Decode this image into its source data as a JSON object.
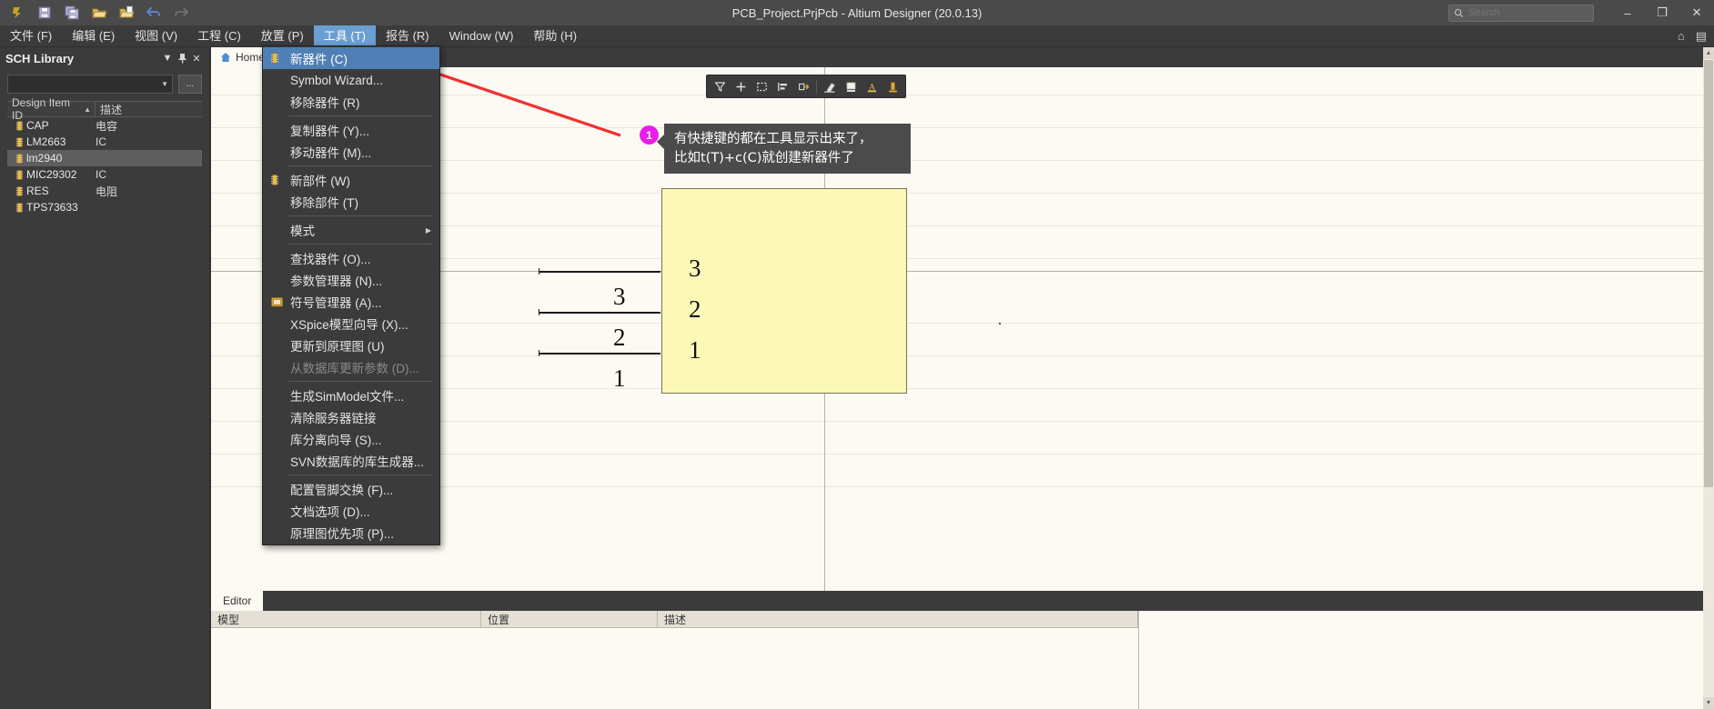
{
  "titlebar": {
    "title": "PCB_Project.PrjPcb - Altium Designer (20.0.13)",
    "quick_icons": [
      {
        "name": "altium-logo-icon",
        "glyph": "A"
      },
      {
        "name": "save-icon",
        "glyph": "save"
      },
      {
        "name": "save-all-icon",
        "glyph": "saveall"
      },
      {
        "name": "open-folder-icon",
        "glyph": "folder"
      },
      {
        "name": "open-project-icon",
        "glyph": "folder2"
      },
      {
        "name": "undo-icon",
        "glyph": "undo"
      },
      {
        "name": "redo-icon",
        "glyph": "redo"
      }
    ],
    "search_placeholder": "Search",
    "search_value": "",
    "minimize_label": "–",
    "maximize_label": "❐",
    "close_label": "✕"
  },
  "menubar": {
    "items": [
      {
        "label": "文件 (F)",
        "active": false
      },
      {
        "label": "编辑 (E)",
        "active": false
      },
      {
        "label": "视图 (V)",
        "active": false
      },
      {
        "label": "工程 (C)",
        "active": false
      },
      {
        "label": "放置 (P)",
        "active": false
      },
      {
        "label": "工具 (T)",
        "active": true
      },
      {
        "label": "报告 (R)",
        "active": false
      },
      {
        "label": "Window (W)",
        "active": false
      },
      {
        "label": "帮助 (H)",
        "active": false
      }
    ],
    "right_icons": [
      {
        "name": "home-icon",
        "glyph": "⌂"
      },
      {
        "name": "panels-icon",
        "glyph": "▤"
      }
    ]
  },
  "tools_menu": {
    "items": [
      {
        "label": "新器件 (C)",
        "icon": "component-icon",
        "highlighted": true,
        "disabled": false,
        "separator_after": false,
        "submenu": false
      },
      {
        "label": "Symbol Wizard...",
        "icon": "",
        "highlighted": false,
        "disabled": false,
        "separator_after": false,
        "submenu": false
      },
      {
        "label": "移除器件 (R)",
        "icon": "",
        "highlighted": false,
        "disabled": false,
        "separator_after": true,
        "submenu": false
      },
      {
        "label": "复制器件 (Y)...",
        "icon": "",
        "highlighted": false,
        "disabled": false,
        "separator_after": false,
        "submenu": false
      },
      {
        "label": "移动器件 (M)...",
        "icon": "",
        "highlighted": false,
        "disabled": false,
        "separator_after": true,
        "submenu": false
      },
      {
        "label": "新部件 (W)",
        "icon": "component-icon",
        "highlighted": false,
        "disabled": false,
        "separator_after": false,
        "submenu": false
      },
      {
        "label": "移除部件 (T)",
        "icon": "",
        "highlighted": false,
        "disabled": false,
        "separator_after": true,
        "submenu": false
      },
      {
        "label": "模式",
        "icon": "",
        "highlighted": false,
        "disabled": false,
        "separator_after": true,
        "submenu": true
      },
      {
        "label": "查找器件 (O)...",
        "icon": "",
        "highlighted": false,
        "disabled": false,
        "separator_after": false,
        "submenu": false
      },
      {
        "label": "参数管理器 (N)...",
        "icon": "",
        "highlighted": false,
        "disabled": false,
        "separator_after": false,
        "submenu": false
      },
      {
        "label": "符号管理器 (A)...",
        "icon": "symbol-manager-icon",
        "highlighted": false,
        "disabled": false,
        "separator_after": false,
        "submenu": false
      },
      {
        "label": "XSpice模型向导 (X)...",
        "icon": "",
        "highlighted": false,
        "disabled": false,
        "separator_after": false,
        "submenu": false
      },
      {
        "label": "更新到原理图 (U)",
        "icon": "",
        "highlighted": false,
        "disabled": false,
        "separator_after": false,
        "submenu": false
      },
      {
        "label": "从数据库更新参数 (D)...",
        "icon": "",
        "highlighted": false,
        "disabled": true,
        "separator_after": true,
        "submenu": false
      },
      {
        "label": "生成SimModel文件...",
        "icon": "",
        "highlighted": false,
        "disabled": false,
        "separator_after": false,
        "submenu": false
      },
      {
        "label": "清除服务器链接",
        "icon": "",
        "highlighted": false,
        "disabled": false,
        "separator_after": false,
        "submenu": false
      },
      {
        "label": "库分离向导 (S)...",
        "icon": "",
        "highlighted": false,
        "disabled": false,
        "separator_after": false,
        "submenu": false
      },
      {
        "label": "SVN数据库的库生成器...",
        "icon": "",
        "highlighted": false,
        "disabled": false,
        "separator_after": true,
        "submenu": false
      },
      {
        "label": "配置管脚交换 (F)...",
        "icon": "",
        "highlighted": false,
        "disabled": false,
        "separator_after": false,
        "submenu": false
      },
      {
        "label": "文档选项 (D)...",
        "icon": "",
        "highlighted": false,
        "disabled": false,
        "separator_after": false,
        "submenu": false
      },
      {
        "label": "原理图优先项 (P)...",
        "icon": "",
        "highlighted": false,
        "disabled": false,
        "separator_after": false,
        "submenu": false
      }
    ]
  },
  "sch_library_panel": {
    "title": "SCH Library",
    "header_buttons": [
      {
        "name": "panel-dropdown-icon",
        "glyph": "▼"
      },
      {
        "name": "pin-icon",
        "glyph": "↯"
      },
      {
        "name": "close-icon",
        "glyph": "✕"
      }
    ],
    "filter_value": "",
    "ellipsis_label": "...",
    "columns": [
      "Design Item ID",
      "描述"
    ],
    "rows": [
      {
        "id": "CAP",
        "desc": "电容",
        "selected": false
      },
      {
        "id": "LM2663",
        "desc": "IC",
        "selected": false
      },
      {
        "id": "lm2940",
        "desc": "",
        "selected": true
      },
      {
        "id": "MIC29302",
        "desc": "IC",
        "selected": false
      },
      {
        "id": "RES",
        "desc": "电阻",
        "selected": false
      },
      {
        "id": "TPS73633",
        "desc": "",
        "selected": false
      }
    ]
  },
  "document_tabs": [
    {
      "label": "Home",
      "icon": "home-icon",
      "active": true
    }
  ],
  "floating_toolbar": {
    "buttons": [
      {
        "name": "filter-icon",
        "glyph": "filter"
      },
      {
        "name": "add-icon",
        "glyph": "plus"
      },
      {
        "name": "select-area-icon",
        "glyph": "dashbox"
      },
      {
        "name": "align-icon",
        "glyph": "align"
      },
      {
        "name": "cross-select-icon",
        "glyph": "cross"
      },
      {
        "name": "eraser-icon",
        "glyph": "eraser"
      },
      {
        "name": "fill-color-icon",
        "glyph": "fill"
      },
      {
        "name": "text-color-icon",
        "glyph": "A"
      },
      {
        "name": "line-color-icon",
        "glyph": "bar"
      }
    ]
  },
  "symbol": {
    "pin_numbers": [
      "3",
      "2",
      "1"
    ],
    "pin_names": [
      "3",
      "2",
      "1"
    ]
  },
  "annotation": {
    "badge_number": "1",
    "text": "有快捷键的都在工具显示出来了，\n比如t(T)+c(C)就创建新器件了",
    "arrow_color": "#f03030",
    "badge_color": "#e81ee8"
  },
  "bottom_panel": {
    "tabs": [
      {
        "label": "Editor",
        "active": true
      }
    ],
    "columns": [
      "模型",
      "位置",
      "描述"
    ],
    "rows": []
  }
}
